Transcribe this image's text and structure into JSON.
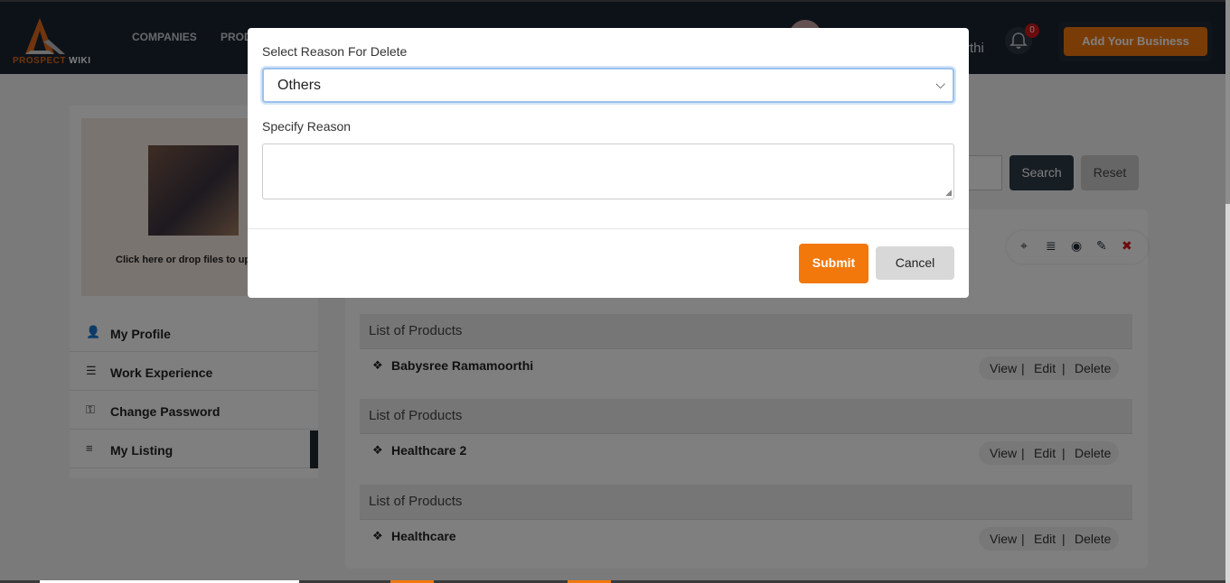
{
  "header": {
    "logo_text_a": "PROSPECT",
    "logo_text_b": "WIKI",
    "nav": [
      "COMPANIES",
      "PROD"
    ],
    "user_name_partial": "rthi",
    "notification_count": "0",
    "add_business_label": "Add Your Business"
  },
  "sidebar": {
    "upload_text": "Click here or drop files to up",
    "items": [
      {
        "label": "My Profile",
        "icon": "user-edit-icon"
      },
      {
        "label": "Work Experience",
        "icon": "list-icon"
      },
      {
        "label": "Change Password",
        "icon": "key-icon"
      },
      {
        "label": "My Listing",
        "icon": "checklist-icon"
      }
    ],
    "active_item": "My Listing"
  },
  "search": {
    "search_label": "Search",
    "reset_label": "Reset"
  },
  "listings": [
    {
      "header": "List of Products",
      "name": "Babysree Ramamoorthi"
    },
    {
      "header": "List of Products",
      "name": "Healthcare 2"
    },
    {
      "header": "List of Products",
      "name": "Healthcare"
    }
  ],
  "row_actions": {
    "view": "View",
    "edit": "Edit",
    "delete": "Delete",
    "separator": "|"
  },
  "card_action_icons": [
    "locate-icon",
    "layers-icon",
    "eye-icon",
    "edit-icon",
    "trash-icon"
  ],
  "modal": {
    "reason_label": "Select Reason For Delete",
    "reason_value": "Others",
    "specify_label": "Specify Reason",
    "specify_value": "",
    "submit_label": "Submit",
    "cancel_label": "Cancel"
  },
  "colors": {
    "accent": "#f2780c",
    "nav_bg": "#1b2530",
    "danger": "#d4161d"
  }
}
